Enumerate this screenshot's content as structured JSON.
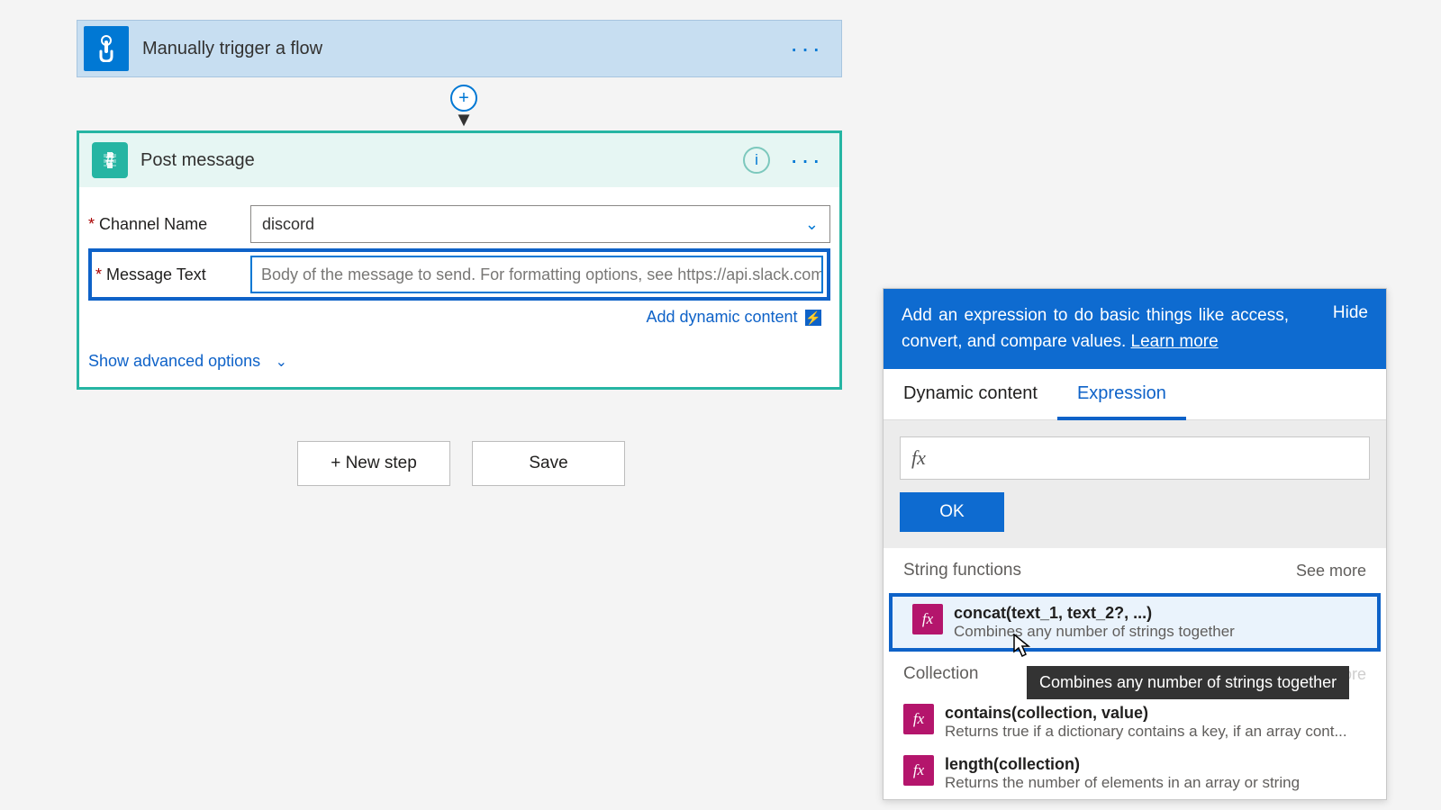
{
  "trigger": {
    "title": "Manually trigger a flow"
  },
  "connector": {
    "plus": "+"
  },
  "action": {
    "title": "Post message",
    "channel_label": "Channel Name",
    "channel_value": "discord",
    "message_label": "Message Text",
    "message_placeholder": "Body of the message to send. For formatting options, see https://api.slack.com",
    "add_dynamic": "Add dynamic content",
    "show_adv": "Show advanced options"
  },
  "buttons": {
    "new_step": "+ New step",
    "save": "Save"
  },
  "panel": {
    "head_text_a": "Add an expression to do basic things like access, convert, and compare values. ",
    "learn_more": "Learn more",
    "hide": "Hide",
    "tab_dynamic": "Dynamic content",
    "tab_expr": "Expression",
    "ok": "OK",
    "group1": "String functions",
    "group2": "Collection",
    "see_more": "See more",
    "fn1_name": "concat(text_1, text_2?, ...)",
    "fn1_desc": "Combines any number of strings together",
    "fn2_name": "contains(collection, value)",
    "fn2_desc": "Returns true if a dictionary contains a key, if an array cont...",
    "fn3_name": "length(collection)",
    "fn3_desc": "Returns the number of elements in an array or string",
    "tooltip": "Combines any number of strings together",
    "fx": "fx"
  }
}
